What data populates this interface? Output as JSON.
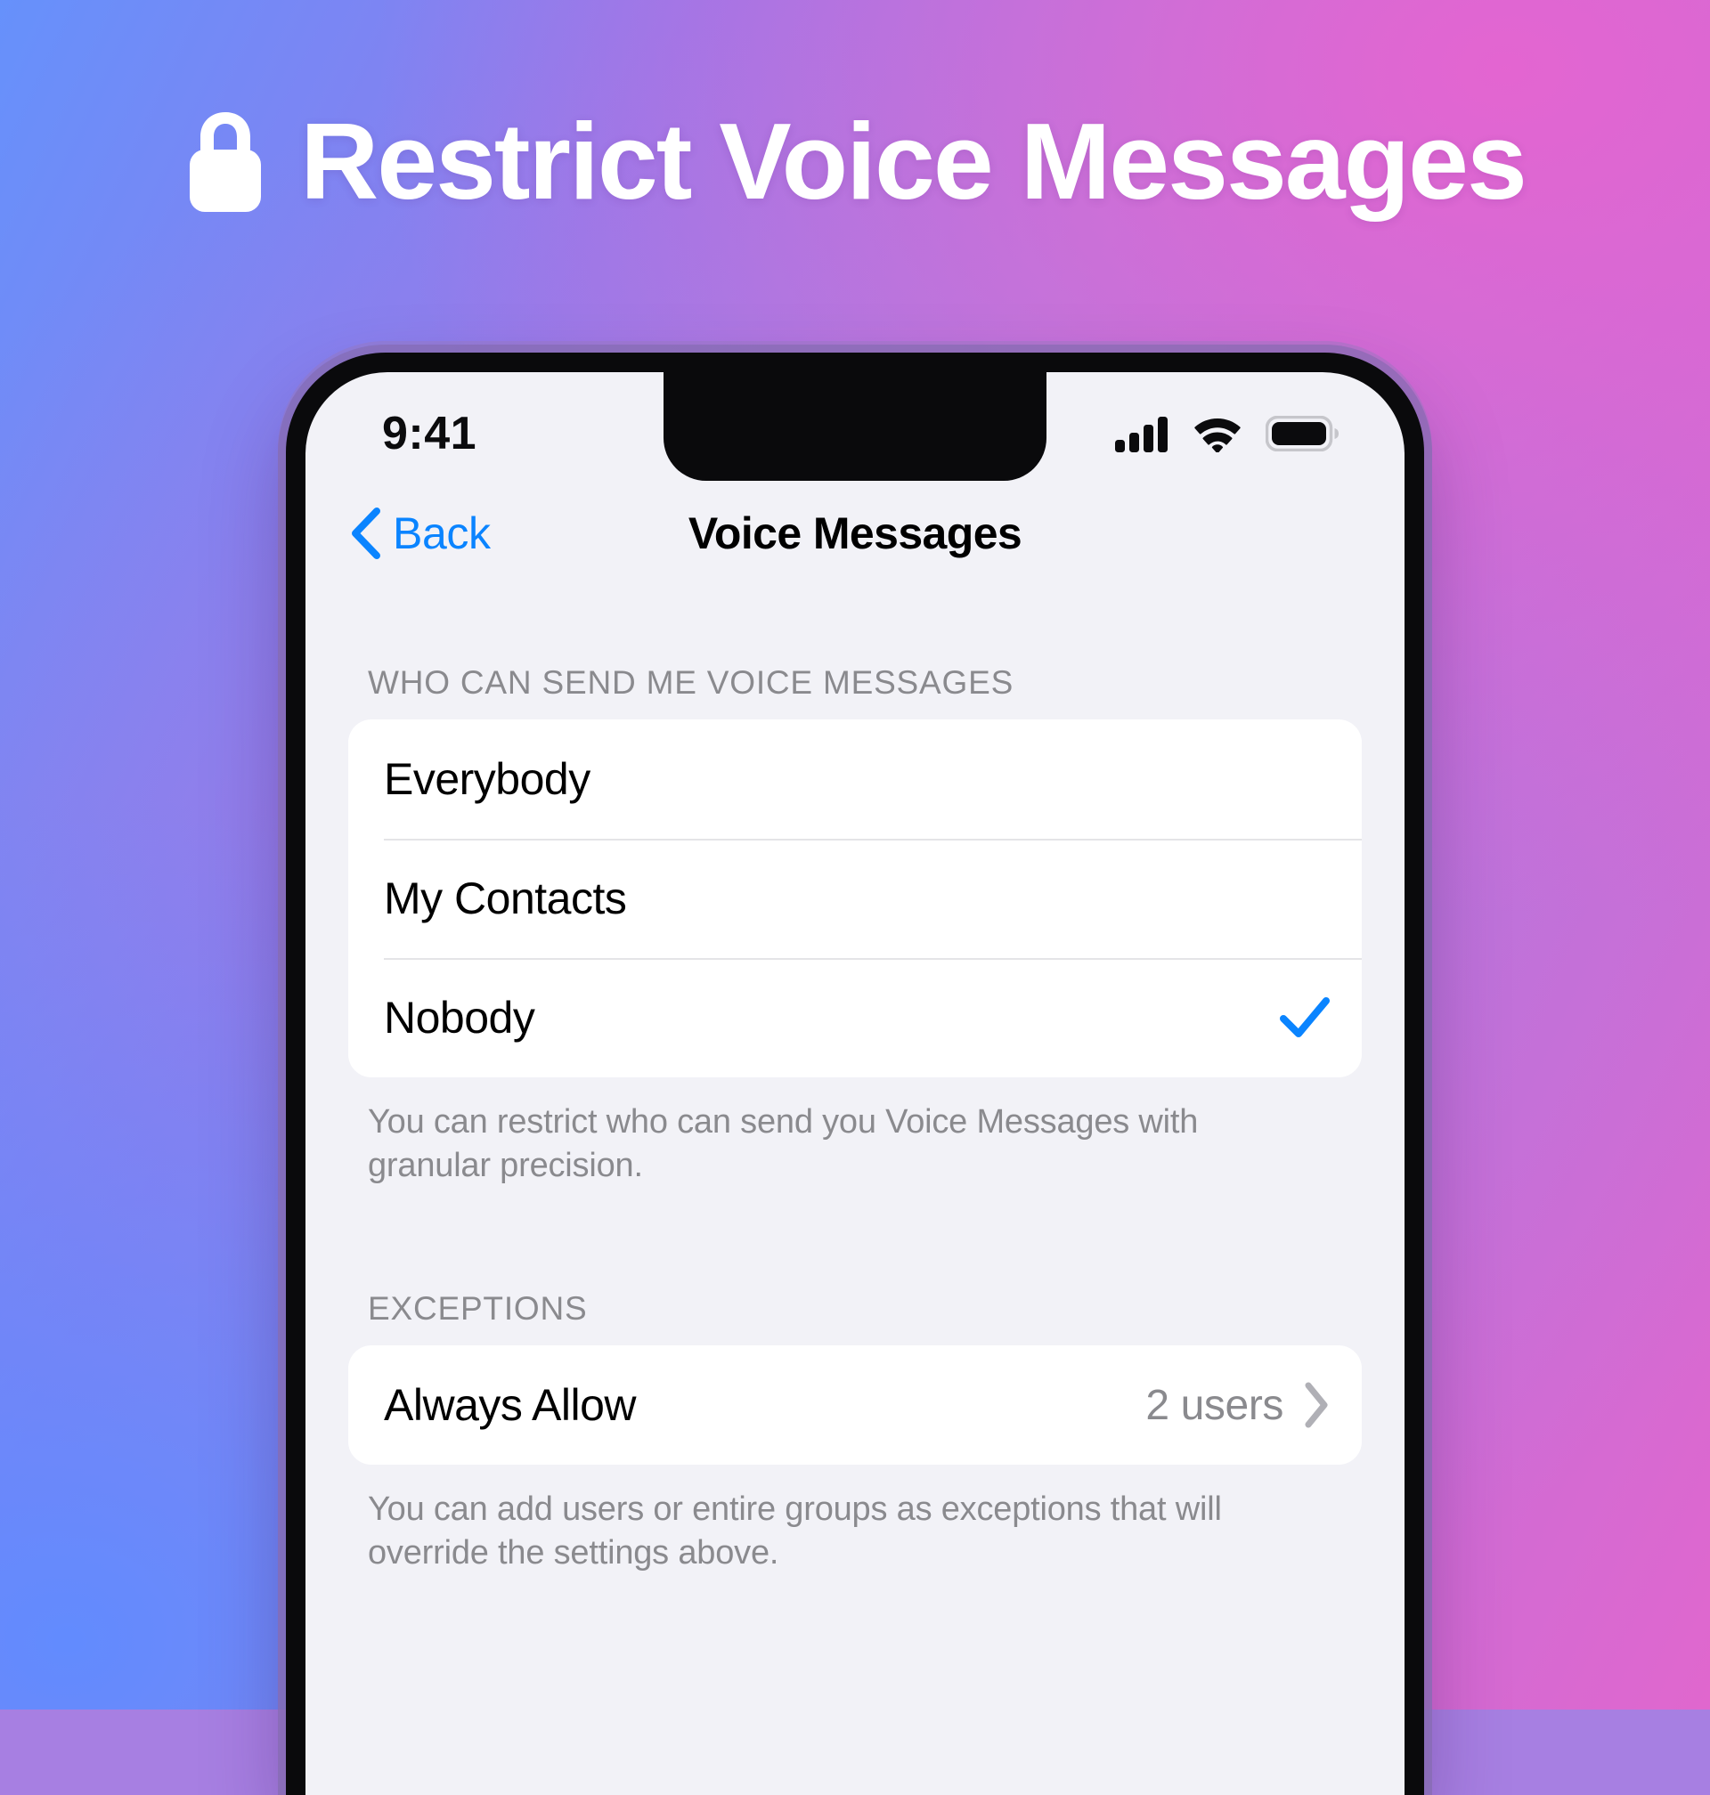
{
  "promo": {
    "headline": "Restrict Voice Messages",
    "lock_icon": "lock-icon",
    "background_colors": {
      "top_left": "#a77fe2",
      "top_right": "#e067ce",
      "bottom_left": "#6691fb",
      "bottom_right": "#a77fe2"
    }
  },
  "phone": {
    "status_bar": {
      "time": "9:41",
      "icons": [
        "cellular-signal-icon",
        "wifi-icon",
        "battery-icon"
      ]
    },
    "nav_bar": {
      "back_label": "Back",
      "back_icon": "chevron-left-icon",
      "title": "Voice Messages"
    },
    "sections": [
      {
        "header": "WHO CAN SEND ME VOICE MESSAGES",
        "rows": [
          {
            "label": "Everybody",
            "selected": false
          },
          {
            "label": "My Contacts",
            "selected": false
          },
          {
            "label": "Nobody",
            "selected": true,
            "accessory": "checkmark-icon"
          }
        ],
        "footer": "You can restrict who can send you Voice Messages with granular precision."
      },
      {
        "header": "EXCEPTIONS",
        "rows": [
          {
            "label": "Always Allow",
            "value": "2 users",
            "accessory": "chevron-right-icon"
          }
        ],
        "footer": "You can add users or entire groups as exceptions that will override the settings above."
      }
    ],
    "accent_color": "#0a84ff"
  }
}
